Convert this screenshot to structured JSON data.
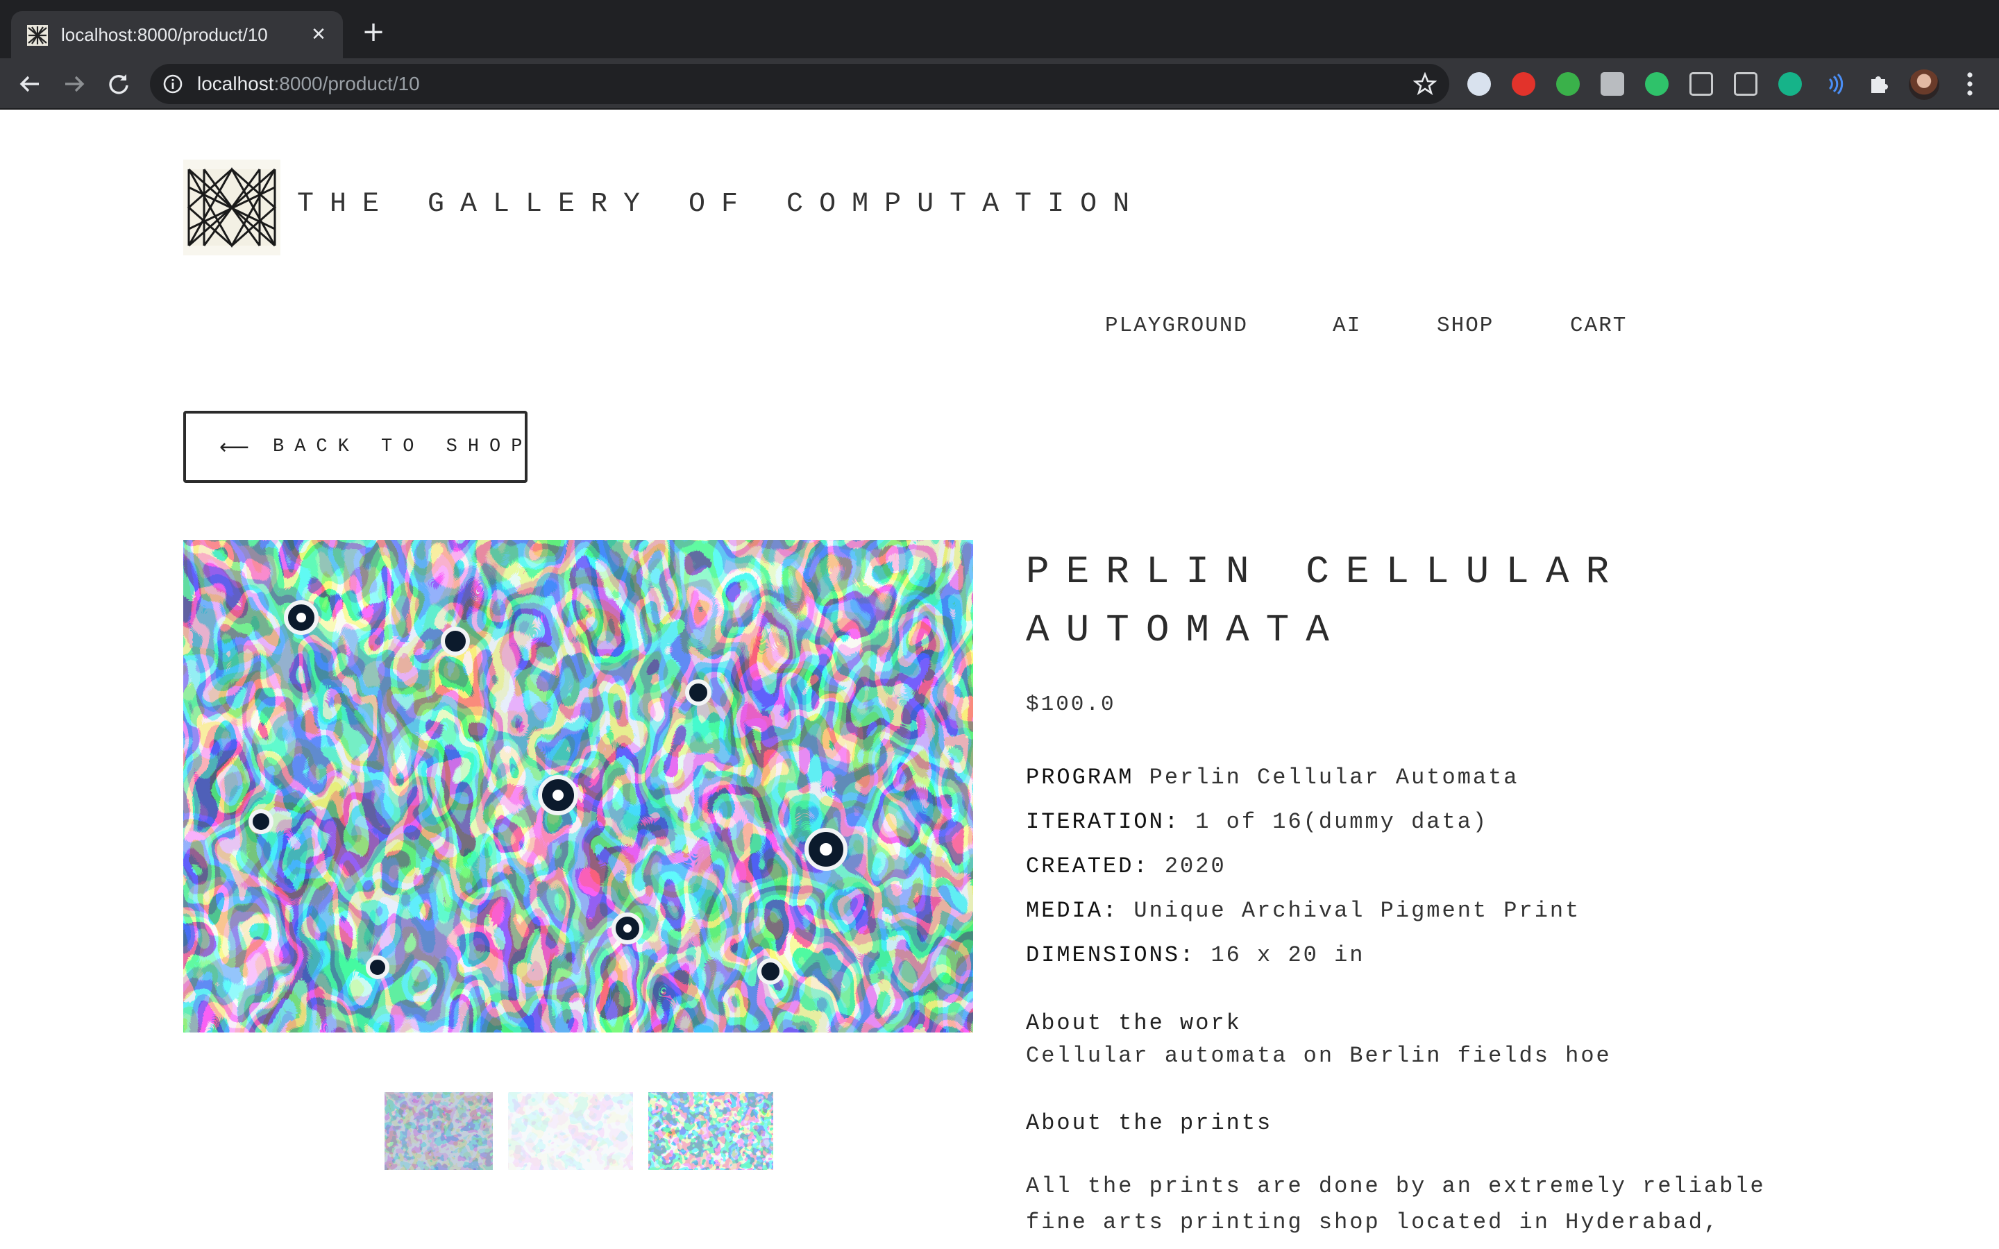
{
  "browser": {
    "tab_title": "localhost:8000/product/10",
    "url_host": "localhost",
    "url_path": ":8000/product/10",
    "extensions": [
      "mask-extension-icon",
      "adblock-icon",
      "pushbullet-icon",
      "hootsuite-icon",
      "mail-extension-icon",
      "grid-extension-icon",
      "document-extension-icon",
      "grammarly-icon",
      "audio-extension-icon"
    ]
  },
  "site": {
    "title": "THE GALLERY OF COMPUTATION",
    "nav": [
      "PLAYGROUND",
      "AI",
      "SHOP",
      "CART"
    ]
  },
  "back_button": {
    "label": "BACK TO SHOP"
  },
  "product": {
    "title_line1": "PERLIN CELLULAR",
    "title_line2": "AUTOMATA",
    "price": "$100.0",
    "specs": [
      {
        "key": "PROGRAM",
        "value": "Perlin Cellular Automata"
      },
      {
        "key": "ITERATION:",
        "value": "1 of 16(dummy data)"
      },
      {
        "key": "CREATED:",
        "value": "2020"
      },
      {
        "key": "MEDIA:",
        "value": "Unique Archival Pigment Print"
      },
      {
        "key": "DIMENSIONS:",
        "value": "16 x 20 in"
      }
    ],
    "about_work_title": "About the work",
    "about_work_text": "Cellular automata on Berlin fields hoe",
    "about_prints_title": "About the prints",
    "about_prints_line1": "All the prints are done by an extremely reliable",
    "about_prints_line2": "fine arts printing shop located in Hyderabad,"
  },
  "colors": {
    "art_dark": "#0f1f33",
    "art_blue": "#2e5a7a",
    "art_teal": "#2f6f77",
    "art_light": "#a9bccd",
    "art_white": "#f2f4f6"
  }
}
